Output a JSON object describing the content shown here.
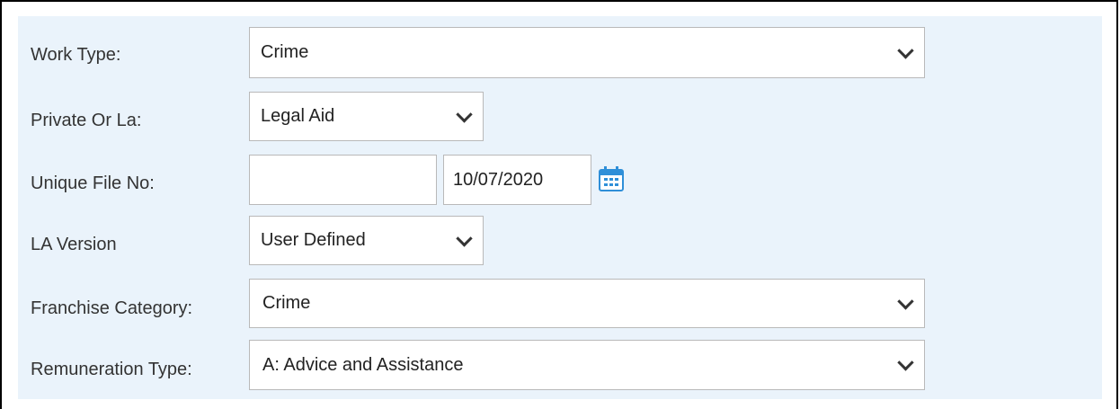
{
  "form": {
    "work_type": {
      "label": "Work Type:",
      "value": "Crime"
    },
    "private_or_la": {
      "label": "Private Or La:",
      "value": "Legal Aid"
    },
    "unique_file_no": {
      "label": "Unique File No:",
      "number_value": "",
      "date_value": "10/07/2020"
    },
    "la_version": {
      "label": "LA Version",
      "value": "User Defined"
    },
    "franchise_category": {
      "label": "Franchise Category:",
      "value": "Crime"
    },
    "remuneration_type": {
      "label": "Remuneration Type:",
      "value": "A: Advice and Assistance"
    }
  },
  "icons": {
    "select_arrow": "chevron-down-icon",
    "date_picker": "calendar-icon"
  },
  "colors": {
    "panel_bg": "#eaf3fb",
    "calendar_accent": "#2f8fd8"
  }
}
